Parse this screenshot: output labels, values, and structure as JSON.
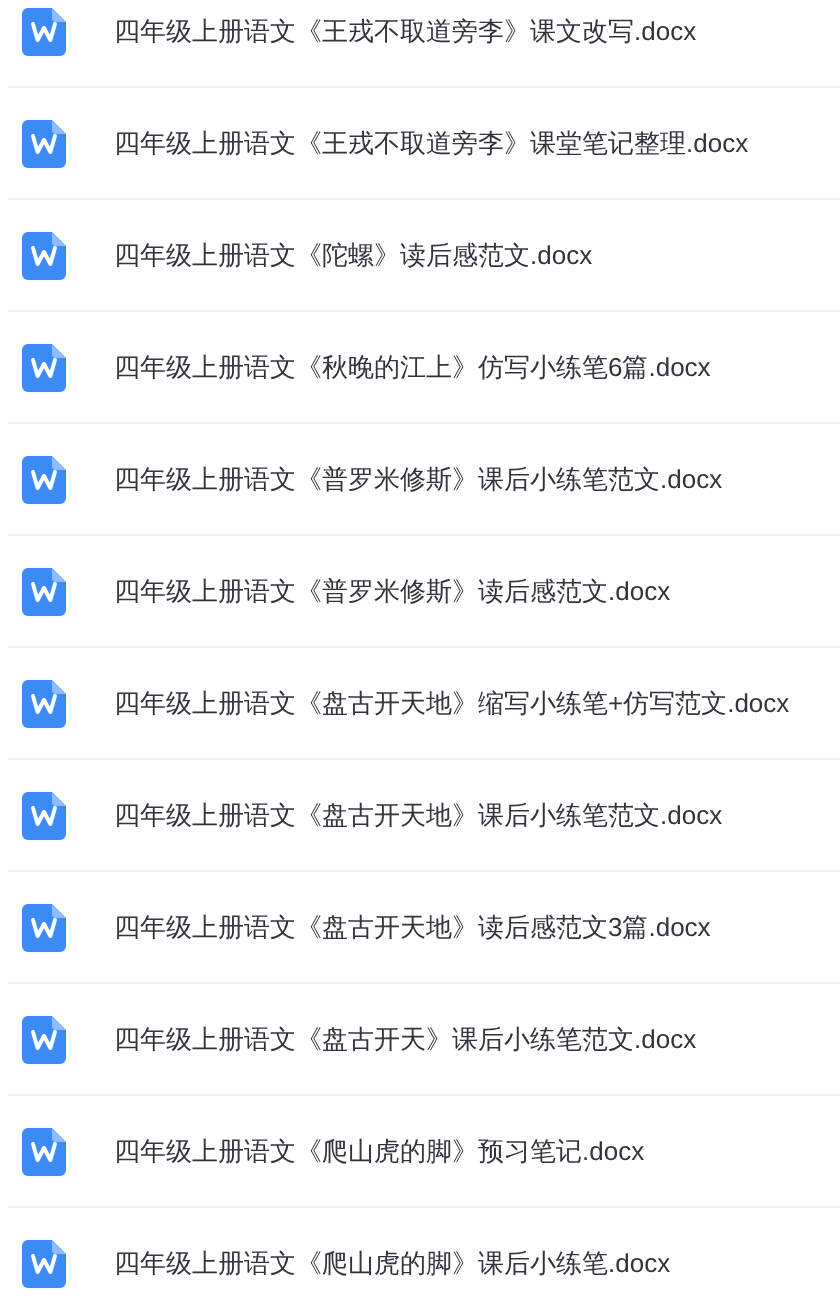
{
  "files": [
    {
      "name": "四年级上册语文《王戎不取道旁李》课文改写.docx"
    },
    {
      "name": "四年级上册语文《王戎不取道旁李》课堂笔记整理.docx"
    },
    {
      "name": "四年级上册语文《陀螺》读后感范文.docx"
    },
    {
      "name": "四年级上册语文《秋晚的江上》仿写小练笔6篇.docx"
    },
    {
      "name": "四年级上册语文《普罗米修斯》课后小练笔范文.docx"
    },
    {
      "name": "四年级上册语文《普罗米修斯》读后感范文.docx"
    },
    {
      "name": "四年级上册语文《盘古开天地》缩写小练笔+仿写范文.docx"
    },
    {
      "name": "四年级上册语文《盘古开天地》课后小练笔范文.docx"
    },
    {
      "name": "四年级上册语文《盘古开天地》读后感范文3篇.docx"
    },
    {
      "name": "四年级上册语文《盘古开天》课后小练笔范文.docx"
    },
    {
      "name": "四年级上册语文《爬山虎的脚》预习笔记.docx"
    },
    {
      "name": "四年级上册语文《爬山虎的脚》课后小练笔.docx"
    }
  ]
}
